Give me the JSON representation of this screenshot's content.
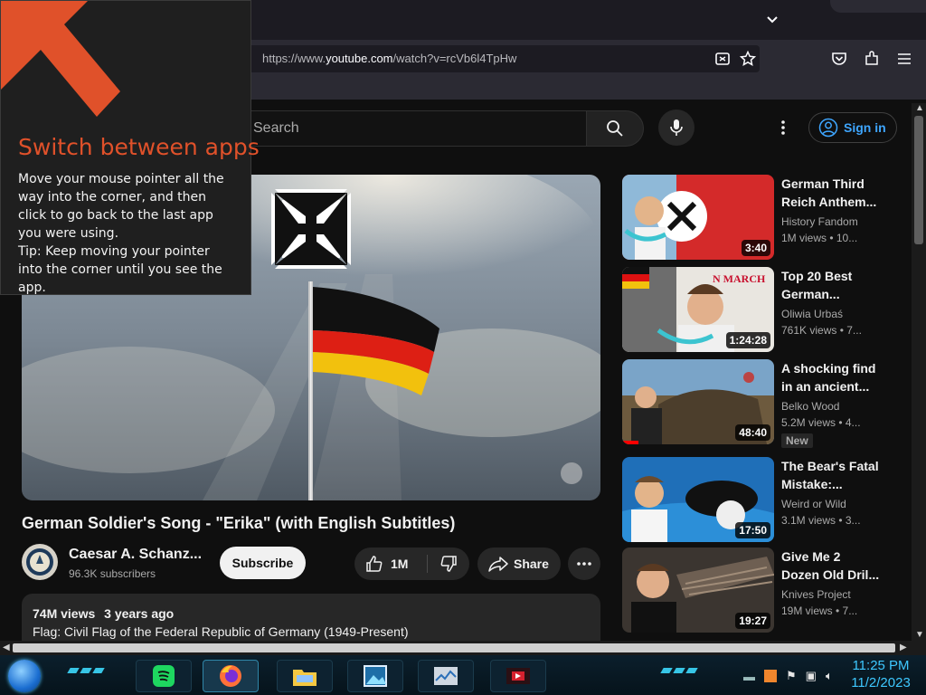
{
  "browser": {
    "url_prefix": "https://www.",
    "url_domain": "youtube.com",
    "url_path": "/watch?v=rcVb6l4TpHw",
    "icons": [
      "tab-list-icon",
      "screenshot-icon",
      "bookmark-star-icon",
      "pocket-icon",
      "extensions-icon",
      "hamburger-menu-icon"
    ]
  },
  "header": {
    "search_placeholder": "Search",
    "signin_label": "Sign in"
  },
  "video": {
    "title": "German Soldier's Song - \"Erika\" (with English Subtitles)",
    "channel_name": "Caesar A. Schanz...",
    "subscribers": "96.3K subscribers",
    "subscribe_label": "Subscribe",
    "likes": "1M",
    "share_label": "Share",
    "views": "74M views",
    "age": "3 years ago",
    "description_line": "Flag: Civil Flag of the Federal Republic of Germany (1949-Present)"
  },
  "recommendations": [
    {
      "title1": "German Third",
      "title2": "Reich Anthem...",
      "channel": "History Fandom",
      "meta": "1M views  •  10...",
      "duration": "3:40",
      "badge": "",
      "thumb_text": ""
    },
    {
      "title1": "Top 20 Best",
      "title2": "German...",
      "channel": "Oliwia Urbaś",
      "meta": "761K views  •  7...",
      "duration": "1:24:28",
      "badge": "",
      "thumb_text": "N MARCH"
    },
    {
      "title1": "A shocking find",
      "title2": "in an ancient...",
      "channel": "Belko Wood",
      "meta": "5.2M views  •  4...",
      "duration": "48:40",
      "badge": "New",
      "thumb_text": ""
    },
    {
      "title1": "The Bear's Fatal",
      "title2": "Mistake:...",
      "channel": "Weird or Wild",
      "meta": "3.1M views  •  3...",
      "duration": "17:50",
      "badge": "",
      "thumb_text": ""
    },
    {
      "title1": "Give Me 2",
      "title2": "Dozen Old Dril...",
      "channel": "Knives Project",
      "meta": "19M views  •  7...",
      "duration": "19:27",
      "badge": "",
      "thumb_text": ""
    }
  ],
  "tip": {
    "title": "Switch between apps",
    "body": "Move your mouse pointer all the way into the corner, and then click to go back to the last app you were using.\nTip: Keep moving your pointer into the corner until you see the app."
  },
  "taskbar": {
    "apps": [
      "spotify-icon",
      "firefox-icon",
      "file-explorer-icon",
      "photo-viewer-icon",
      "task-manager-icon",
      "media-app-icon"
    ],
    "time": "11:25 PM",
    "date": "11/2/2023"
  },
  "colors": {
    "accent_blue": "#3ea6ff",
    "tip_orange": "#e0512a",
    "clock_cyan": "#3ec8ff"
  }
}
